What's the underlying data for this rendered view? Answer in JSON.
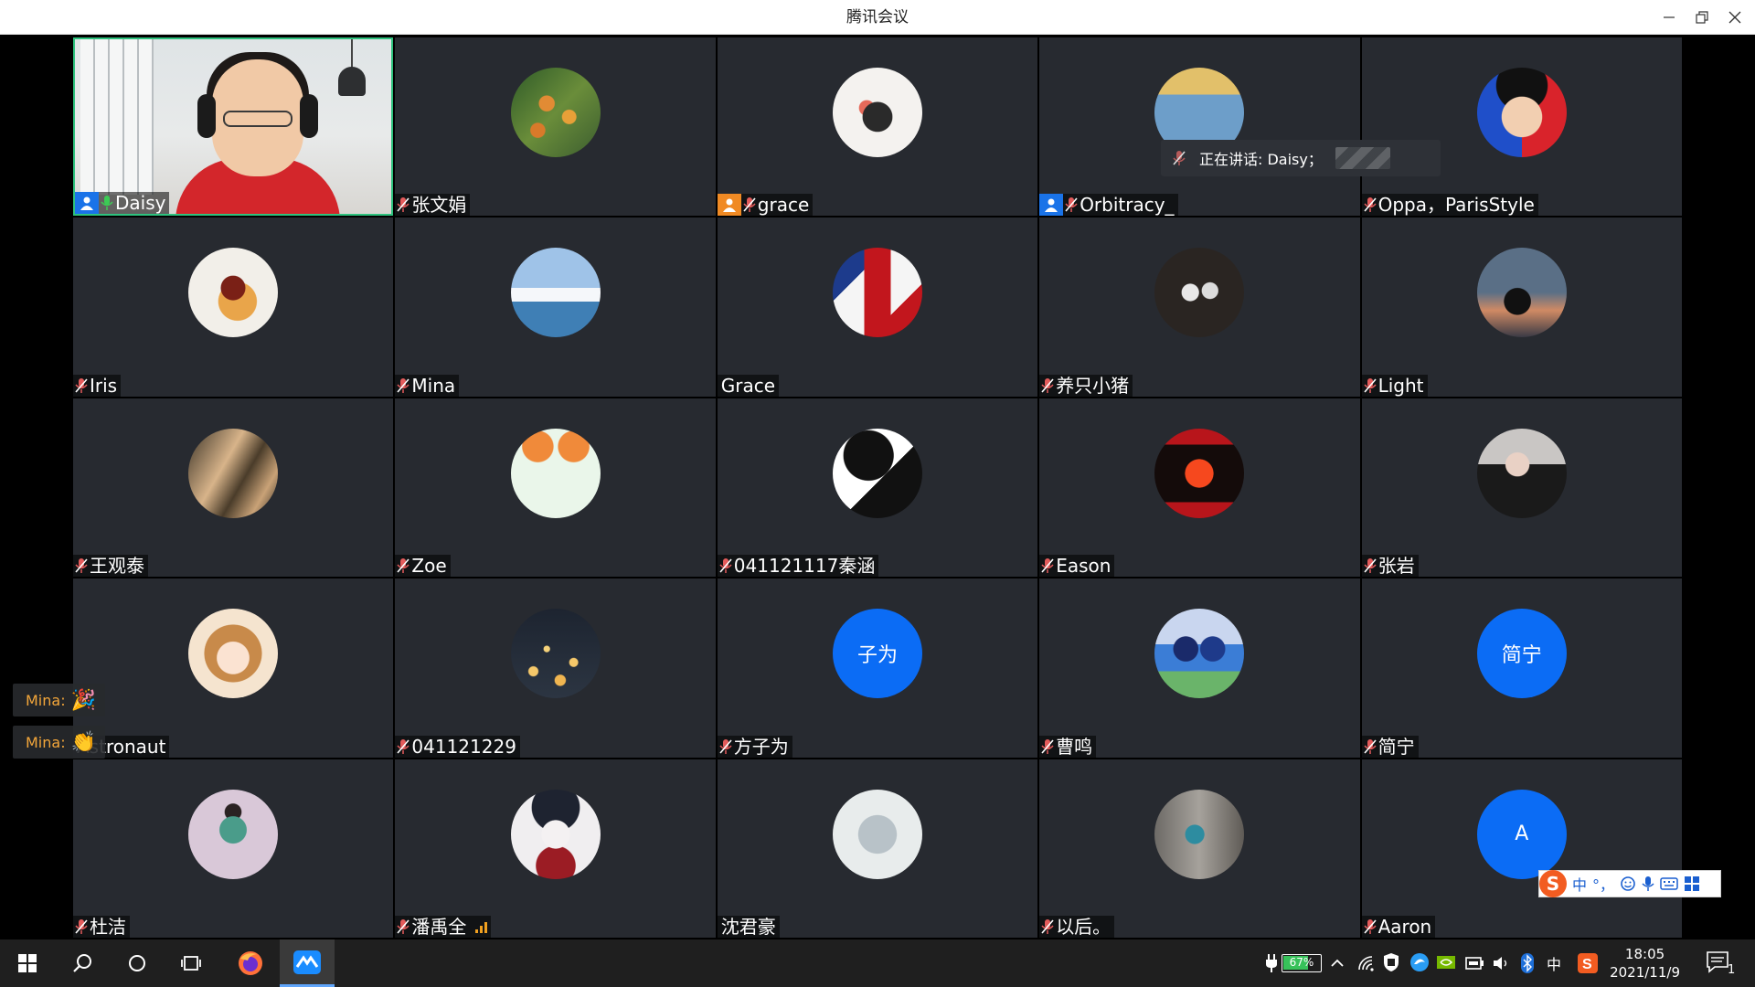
{
  "window": {
    "title": "腾讯会议"
  },
  "speaking": {
    "text": "正在讲话: Daisy；"
  },
  "participants": [
    {
      "name": "Daisy",
      "mic": "on",
      "role": "host",
      "video": true,
      "active": true
    },
    {
      "name": "张文娟",
      "mic": "muted",
      "avatar": "photo-flowers"
    },
    {
      "name": "grace",
      "mic": "muted",
      "role": "cohost",
      "avatar": "photo-girl-drawing"
    },
    {
      "name": "Orbitracy_",
      "mic": "muted",
      "role": "host",
      "avatar": "photo-selfie"
    },
    {
      "name": "Oppa，ParisStyle",
      "mic": "muted",
      "avatar": "photo-cartoon-glasses"
    },
    {
      "name": "Iris",
      "mic": "muted",
      "avatar": "photo-food"
    },
    {
      "name": "Mina",
      "mic": "muted",
      "avatar": "photo-beach"
    },
    {
      "name": "Grace",
      "mic": "none",
      "avatar": "photo-phone-booth"
    },
    {
      "name": "养只小猪",
      "mic": "muted",
      "avatar": "photo-dark"
    },
    {
      "name": "Light",
      "mic": "muted",
      "avatar": "photo-sunset-silhouette"
    },
    {
      "name": "王观泰",
      "mic": "muted",
      "avatar": "photo-feather"
    },
    {
      "name": "Zoe",
      "mic": "muted",
      "avatar": "photo-bunny"
    },
    {
      "name": "041121117秦涵",
      "mic": "muted",
      "avatar": "photo-anime-bw"
    },
    {
      "name": "Eason",
      "mic": "muted",
      "avatar": "photo-red-six"
    },
    {
      "name": "张岩",
      "mic": "muted",
      "avatar": "photo-woman-dark"
    },
    {
      "name": "Astronaut",
      "mic": "none",
      "avatar": "photo-anime-girl"
    },
    {
      "name": "041121229",
      "mic": "muted",
      "avatar": "photo-lanterns"
    },
    {
      "name": "方子为",
      "mic": "muted",
      "initials": "子为"
    },
    {
      "name": "曹鸣",
      "mic": "muted",
      "avatar": "photo-anime-boys"
    },
    {
      "name": "简宁",
      "mic": "muted",
      "initials": "简宁"
    },
    {
      "name": "杜洁",
      "mic": "muted",
      "avatar": "photo-dunhuang"
    },
    {
      "name": "潘禹全",
      "mic": "muted",
      "signal": "weak",
      "avatar": "photo-anime-white"
    },
    {
      "name": "沈君豪",
      "mic": "none",
      "avatar": "photo-baby"
    },
    {
      "name": "以后。",
      "mic": "muted",
      "avatar": "photo-man-street"
    },
    {
      "name": "Aaron",
      "mic": "muted",
      "initials": "A"
    }
  ],
  "reactions": [
    {
      "user": "Mina:",
      "emoji": "🎉"
    },
    {
      "user": "Mina:",
      "emoji": "👏"
    }
  ],
  "ime": {
    "mode": "中",
    "punct": "°，"
  },
  "taskbar": {
    "battery": "67%",
    "lang": "中",
    "time": "18:05",
    "date": "2021/11/9",
    "notifications": "1"
  }
}
